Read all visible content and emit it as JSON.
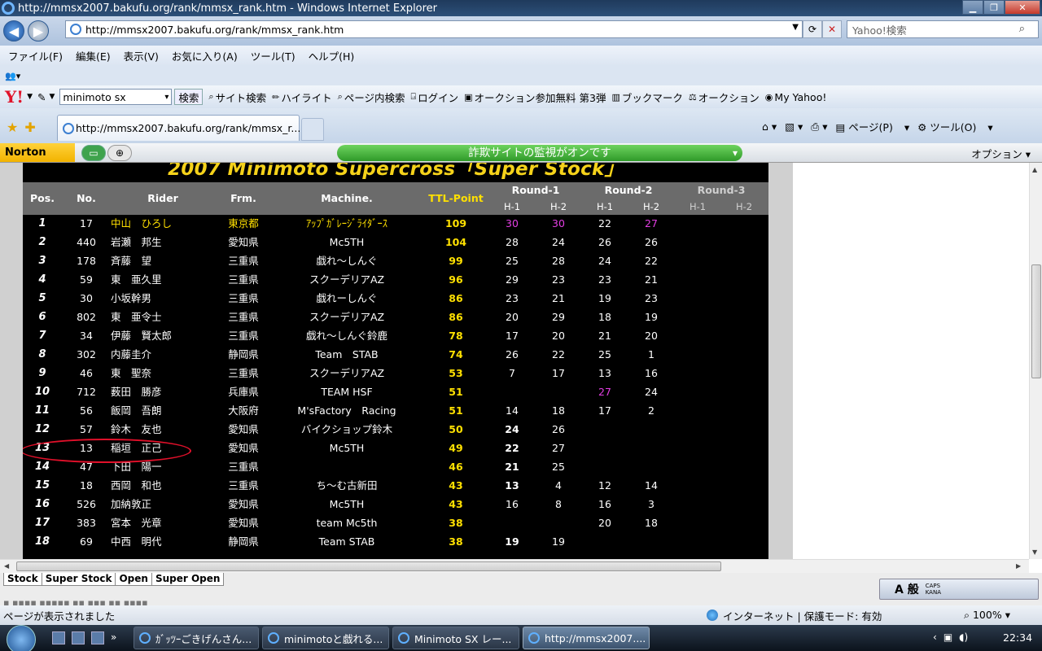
{
  "window": {
    "title": "http://mmsx2007.bakufu.org/rank/mmsx_rank.htm - Windows Internet Explorer"
  },
  "address": {
    "url": "http://mmsx2007.bakufu.org/rank/mmsx_rank.htm",
    "search_placeholder": "Yahoo!検索"
  },
  "menu": [
    "ファイル(F)",
    "編集(E)",
    "表示(V)",
    "お気に入り(A)",
    "ツール(T)",
    "ヘルプ(H)"
  ],
  "ytoolbar": {
    "search_value": "minimoto sx",
    "search_btn": "検索",
    "items": [
      "サイト検索",
      "ハイライト",
      "ページ内検索",
      "ログイン",
      "オークション参加無料 第3弾",
      "ブックマーク",
      "オークション",
      "My Yahoo!"
    ]
  },
  "tab": {
    "label": "http://mmsx2007.bakufu.org/rank/mmsx_r...",
    "page_menu": "ページ(P)",
    "tools_menu": "ツール(O)"
  },
  "norton": {
    "logo": "Norton",
    "safe_text": "詐欺サイトの監視がオンです",
    "options": "オプション"
  },
  "ranking": {
    "title": "2007 Minimoto Supercross「Super Stock」",
    "headers": {
      "pos": "Pos.",
      "no": "No.",
      "rider": "Rider",
      "frm": "Frm.",
      "machine": "Machine.",
      "ttl": "TTL-Point",
      "round1": "Round-1",
      "round2": "Round-2",
      "round3": "Round-3",
      "h1": "H-1",
      "h2": "H-2"
    },
    "rows": [
      {
        "pos": "1",
        "no": "17",
        "rider": "中山　ひろし",
        "frm": "東京都",
        "machine": "ｱｯﾌﾟｶﾞﾚｰｼﾞﾗｲﾀﾞｰｽ",
        "ttl": "109",
        "r1h1": "30",
        "r1h2": "30",
        "r2h1": "22",
        "r2h2": "27"
      },
      {
        "pos": "2",
        "no": "440",
        "rider": "岩瀬　邦生",
        "frm": "愛知県",
        "machine": "Mc5TH",
        "ttl": "104",
        "r1h1": "28",
        "r1h2": "24",
        "r2h1": "26",
        "r2h2": "26"
      },
      {
        "pos": "3",
        "no": "178",
        "rider": "斉藤　望",
        "frm": "三重県",
        "machine": "戯れ～しんぐ",
        "ttl": "99",
        "r1h1": "25",
        "r1h2": "28",
        "r2h1": "24",
        "r2h2": "22"
      },
      {
        "pos": "4",
        "no": "59",
        "rider": "東　亜久里",
        "frm": "三重県",
        "machine": "スクーデリアAZ",
        "ttl": "96",
        "r1h1": "29",
        "r1h2": "23",
        "r2h1": "23",
        "r2h2": "21"
      },
      {
        "pos": "5",
        "no": "30",
        "rider": "小坂幹男",
        "frm": "三重県",
        "machine": "戯れーしんぐ",
        "ttl": "86",
        "r1h1": "23",
        "r1h2": "21",
        "r2h1": "19",
        "r2h2": "23"
      },
      {
        "pos": "6",
        "no": "802",
        "rider": "東　亜令士",
        "frm": "三重県",
        "machine": "スクーデリアAZ",
        "ttl": "86",
        "r1h1": "20",
        "r1h2": "29",
        "r2h1": "18",
        "r2h2": "19"
      },
      {
        "pos": "7",
        "no": "34",
        "rider": "伊藤　賢太郎",
        "frm": "三重県",
        "machine": "戯れ～しんぐ鈴鹿",
        "ttl": "78",
        "r1h1": "17",
        "r1h2": "20",
        "r2h1": "21",
        "r2h2": "20"
      },
      {
        "pos": "8",
        "no": "302",
        "rider": "内藤圭介",
        "frm": "静岡県",
        "machine": "Team　STAB",
        "ttl": "74",
        "r1h1": "26",
        "r1h2": "22",
        "r2h1": "25",
        "r2h2": "1"
      },
      {
        "pos": "9",
        "no": "46",
        "rider": "東　聖奈",
        "frm": "三重県",
        "machine": "スクーデリアAZ",
        "ttl": "53",
        "r1h1": "7",
        "r1h2": "17",
        "r2h1": "13",
        "r2h2": "16"
      },
      {
        "pos": "10",
        "no": "712",
        "rider": "薮田　勝彦",
        "frm": "兵庫県",
        "machine": "TEAM HSF",
        "ttl": "51",
        "r1h1": "",
        "r1h2": "",
        "r2h1": "27",
        "r2h2": "24"
      },
      {
        "pos": "11",
        "no": "56",
        "rider": "飯岡　吾朗",
        "frm": "大阪府",
        "machine": "M'sFactory　Racing",
        "ttl": "51",
        "r1h1": "14",
        "r1h2": "18",
        "r2h1": "17",
        "r2h2": "2"
      },
      {
        "pos": "12",
        "no": "57",
        "rider": "鈴木　友也",
        "frm": "愛知県",
        "machine": "バイクショップ鈴木",
        "ttl": "50",
        "r1h1": "24",
        "r1h2": "26",
        "r2h1": "",
        "r2h2": ""
      },
      {
        "pos": "13",
        "no": "13",
        "rider": "稲垣　正己",
        "frm": "愛知県",
        "machine": "Mc5TH",
        "ttl": "49",
        "r1h1": "22",
        "r1h2": "27",
        "r2h1": "",
        "r2h2": ""
      },
      {
        "pos": "14",
        "no": "47",
        "rider": "下田　陽一",
        "frm": "三重県",
        "machine": "",
        "ttl": "46",
        "r1h1": "21",
        "r1h2": "25",
        "r2h1": "",
        "r2h2": ""
      },
      {
        "pos": "15",
        "no": "18",
        "rider": "西岡　和也",
        "frm": "三重県",
        "machine": "ち～む古新田",
        "ttl": "43",
        "r1h1": "13",
        "r1h2": "4",
        "r2h1": "12",
        "r2h2": "14"
      },
      {
        "pos": "16",
        "no": "526",
        "rider": "加納敦正",
        "frm": "愛知県",
        "machine": "Mc5TH",
        "ttl": "43",
        "r1h1": "16",
        "r1h2": "8",
        "r2h1": "16",
        "r2h2": "3"
      },
      {
        "pos": "17",
        "no": "383",
        "rider": "宮本　光章",
        "frm": "愛知県",
        "machine": "team Mc5th",
        "ttl": "38",
        "r1h1": "",
        "r1h2": "",
        "r2h1": "20",
        "r2h2": "18"
      },
      {
        "pos": "18",
        "no": "69",
        "rider": "中西　明代",
        "frm": "静岡県",
        "machine": "Team STAB",
        "ttl": "38",
        "r1h1": "19",
        "r1h2": "19",
        "r2h1": "",
        "r2h2": ""
      }
    ]
  },
  "sheet_tabs": [
    "Stock",
    "Super Stock",
    "Open",
    "Super Open"
  ],
  "ime": {
    "label": "A 般",
    "caps": "CAPS",
    "kana": "KANA"
  },
  "status": {
    "text": "ページが表示されました",
    "zone": "インターネット | 保護モード: 有効",
    "zoom": "100%"
  },
  "taskbar": {
    "items": [
      "ｶﾞｯﾂｰごきげんさん...",
      "minimotoと戯れる...",
      "Minimoto SX レー...",
      "http://mmsx2007...."
    ],
    "time": "22:34"
  },
  "colors": {
    "highlight_pink": "#e23ee2",
    "ttl_yellow": "#ffe000",
    "circle_red": "#e0102a"
  }
}
